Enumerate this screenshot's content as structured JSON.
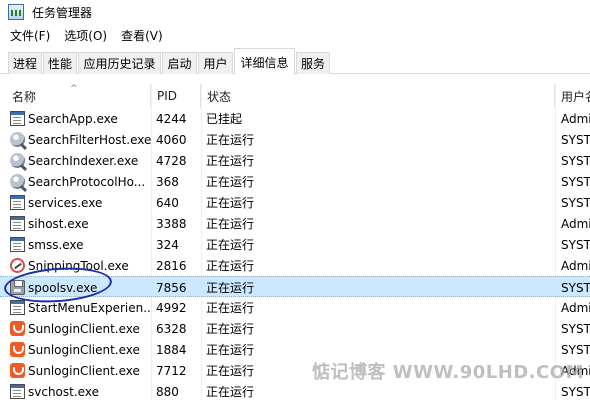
{
  "window": {
    "title": "任务管理器"
  },
  "menu": [
    {
      "label": "文件(F)"
    },
    {
      "label": "选项(O)"
    },
    {
      "label": "查看(V)"
    }
  ],
  "tabs": [
    {
      "label": "进程"
    },
    {
      "label": "性能"
    },
    {
      "label": "应用历史记录"
    },
    {
      "label": "启动"
    },
    {
      "label": "用户"
    },
    {
      "label": "详细信息",
      "active": true
    },
    {
      "label": "服务"
    }
  ],
  "columns": {
    "name": "名称",
    "pid": "PID",
    "status": "状态",
    "user": "用户名"
  },
  "rows": [
    {
      "name": "SearchApp.exe",
      "pid": "4244",
      "status": "已挂起",
      "user": "Admi",
      "icon": "window-icon"
    },
    {
      "name": "SearchFilterHost.exe",
      "pid": "4060",
      "status": "正在运行",
      "user": "SYST",
      "icon": "search-icon"
    },
    {
      "name": "SearchIndexer.exe",
      "pid": "4728",
      "status": "正在运行",
      "user": "SYST",
      "icon": "search-icon"
    },
    {
      "name": "SearchProtocolHo...",
      "pid": "368",
      "status": "正在运行",
      "user": "SYST",
      "icon": "search-icon"
    },
    {
      "name": "services.exe",
      "pid": "640",
      "status": "正在运行",
      "user": "SYST",
      "icon": "window-icon"
    },
    {
      "name": "sihost.exe",
      "pid": "3388",
      "status": "正在运行",
      "user": "Admi",
      "icon": "window-icon"
    },
    {
      "name": "smss.exe",
      "pid": "324",
      "status": "正在运行",
      "user": "SYST",
      "icon": "window-icon"
    },
    {
      "name": "SnippingTool.exe",
      "pid": "2816",
      "status": "正在运行",
      "user": "Admi",
      "icon": "snipping-tool-icon"
    },
    {
      "name": "spoolsv.exe",
      "pid": "7856",
      "status": "正在运行",
      "user": "SYST",
      "icon": "printer-icon",
      "selected": true
    },
    {
      "name": "StartMenuExperien...",
      "pid": "4992",
      "status": "正在运行",
      "user": "Admi",
      "icon": "window-icon"
    },
    {
      "name": "SunloginClient.exe",
      "pid": "6328",
      "status": "正在运行",
      "user": "SYST",
      "icon": "sunlogin-icon"
    },
    {
      "name": "SunloginClient.exe",
      "pid": "1884",
      "status": "正在运行",
      "user": "SYST",
      "icon": "sunlogin-icon"
    },
    {
      "name": "SunloginClient.exe",
      "pid": "7712",
      "status": "正在运行",
      "user": "Admi",
      "icon": "sunlogin-icon"
    },
    {
      "name": "svchost.exe",
      "pid": "880",
      "status": "正在运行",
      "user": "SYST",
      "icon": "window-icon"
    }
  ],
  "watermark": "惦记博客 WWW.90LHD.COM",
  "colors": {
    "selection": "#cce8ff",
    "annotation": "#1b2fa8",
    "sunlogin": "#f15a24"
  }
}
